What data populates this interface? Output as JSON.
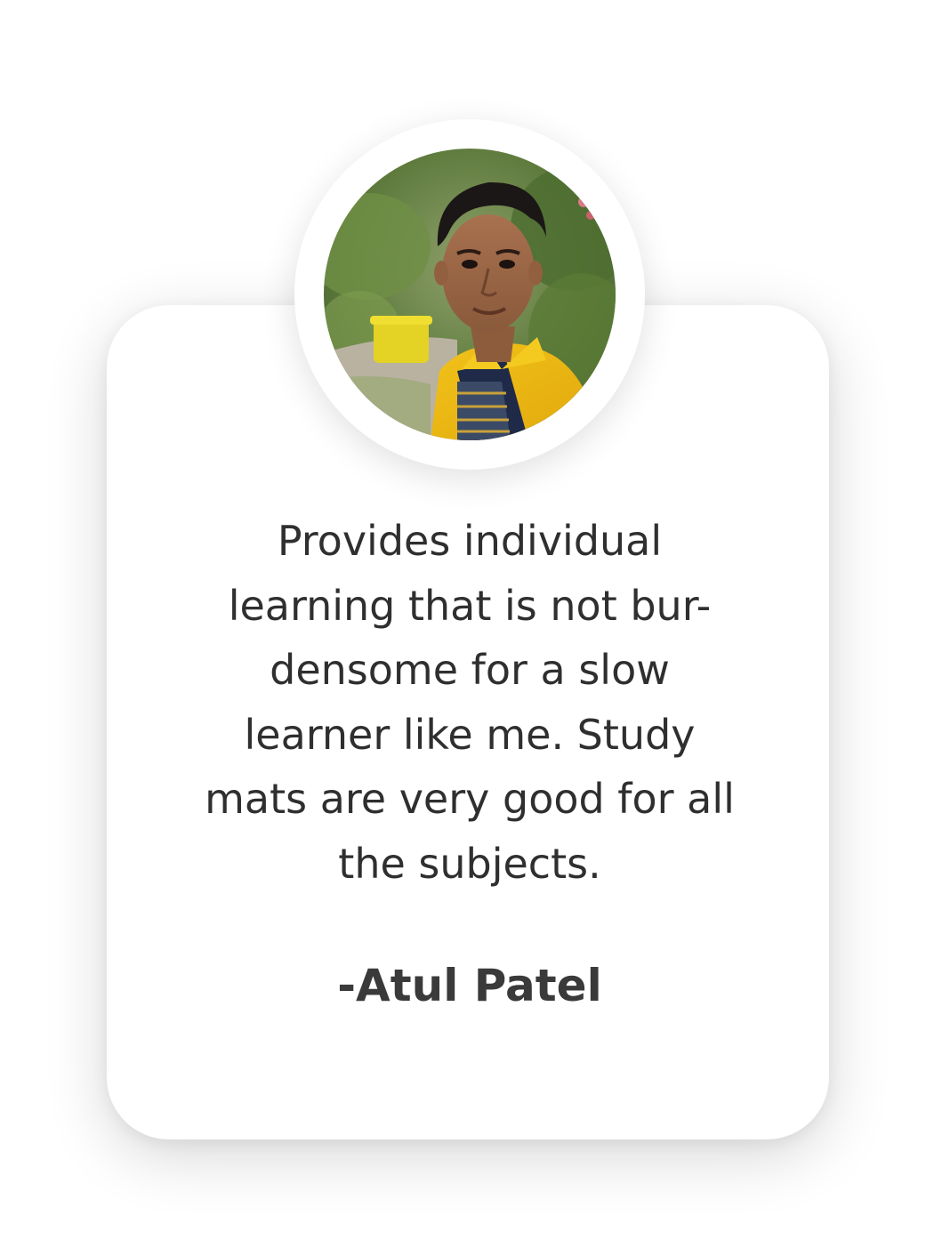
{
  "testimonial": {
    "photo_icon": "student-photo",
    "quote_lines": [
      "Provides individual",
      "learning that is not bur-",
      "densome for a slow",
      "learner like me. Study",
      "mats are very good for all",
      "the subjects."
    ],
    "author": "-Atul Patel"
  }
}
